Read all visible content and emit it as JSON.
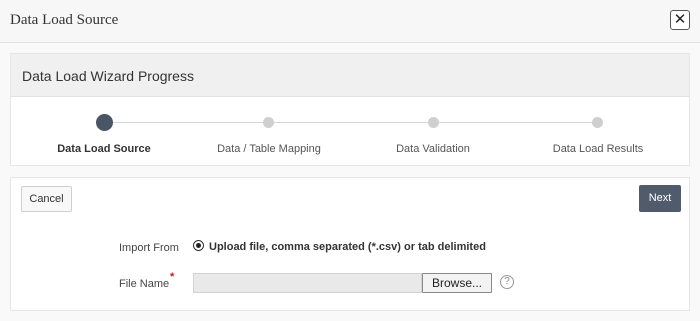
{
  "dialog": {
    "title": "Data Load Source",
    "close_symbol": "✕"
  },
  "progress": {
    "title": "Data Load Wizard Progress",
    "steps": [
      {
        "label": "Data Load Source",
        "active": true
      },
      {
        "label": "Data / Table Mapping",
        "active": false
      },
      {
        "label": "Data Validation",
        "active": false
      },
      {
        "label": "Data Load Results",
        "active": false
      }
    ]
  },
  "actions": {
    "cancel_label": "Cancel",
    "next_label": "Next"
  },
  "form": {
    "import_from_label": "Import From",
    "import_option": "Upload file, comma separated (*.csv) or tab delimited",
    "file_name_label": "File Name",
    "required_marker": "*",
    "browse_label": "Browse...",
    "help_symbol": "?"
  },
  "colors": {
    "accent": "#505c6b",
    "active_step": "#4a5666",
    "inactive_step": "#cfcfcf",
    "required": "#dd1111"
  },
  "icons": [
    "close-icon",
    "radio-icon",
    "help-icon"
  ]
}
